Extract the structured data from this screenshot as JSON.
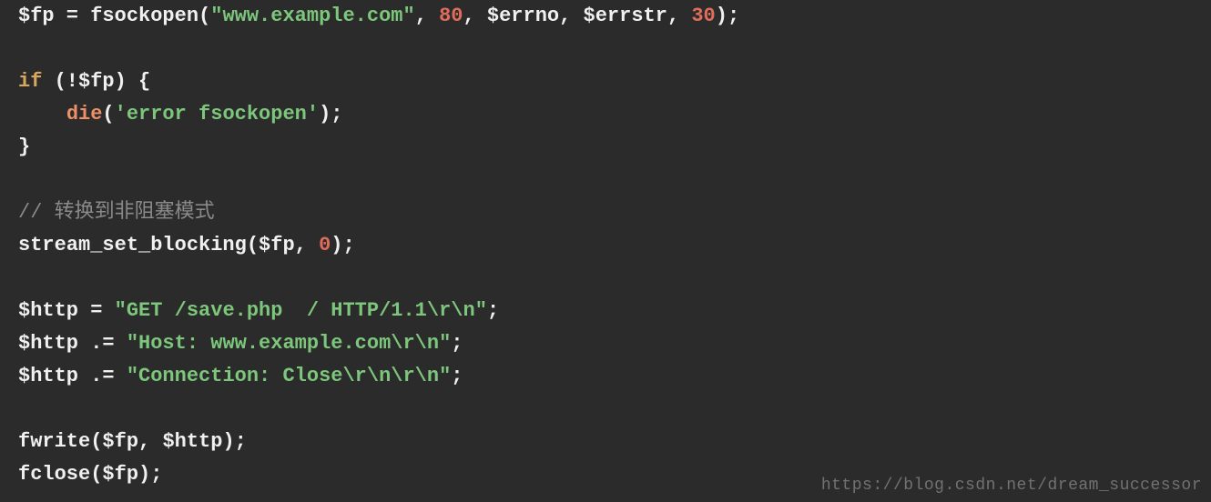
{
  "code": {
    "line1": {
      "var_fp": "$fp",
      "assign": " = ",
      "fn_fsockopen": "fsockopen",
      "open": "(",
      "arg_host": "\"www.example.com\"",
      "c1": ", ",
      "arg_port": "80",
      "c2": ", ",
      "arg_errno": "$errno",
      "c3": ", ",
      "arg_errstr": "$errstr",
      "c4": ", ",
      "arg_timeout": "30",
      "close": ");"
    },
    "line3": {
      "kw_if": "if",
      "open": " (!",
      "var_fp": "$fp",
      "close": ") {"
    },
    "line4": {
      "indent": "    ",
      "fn_die": "die",
      "open": "(",
      "arg_msg": "'error fsockopen'",
      "close": ");"
    },
    "line5": {
      "brace": "}"
    },
    "line7": {
      "comment_slashes": "// ",
      "comment_text": "转换到非阻塞模式"
    },
    "line8": {
      "fn_ssb": "stream_set_blocking",
      "open": "(",
      "arg_fp": "$fp",
      "c1": ", ",
      "arg_zero": "0",
      "close": ");"
    },
    "line10": {
      "var_http": "$http",
      "assign": " = ",
      "str": "\"GET /save.php  / HTTP/1.1\\r\\n\"",
      "end": ";"
    },
    "line11": {
      "var_http": "$http",
      "assign": " .= ",
      "str": "\"Host: www.example.com\\r\\n\"",
      "end": ";"
    },
    "line12": {
      "var_http": "$http",
      "assign": " .= ",
      "str": "\"Connection: Close\\r\\n\\r\\n\"",
      "end": ";"
    },
    "line14": {
      "fn_fwrite": "fwrite",
      "open": "(",
      "arg_fp": "$fp",
      "c1": ", ",
      "arg_http": "$http",
      "close": ");"
    },
    "line15": {
      "fn_fclose": "fclose",
      "open": "(",
      "arg_fp": "$fp",
      "close": ");"
    }
  },
  "watermark": "https://blog.csdn.net/dream_successor"
}
